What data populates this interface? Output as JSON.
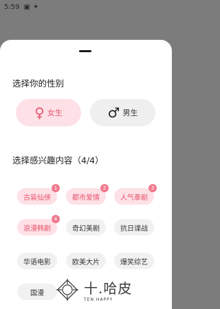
{
  "status_bar": {
    "time": "5:59",
    "icons": [
      "sim-card-icon",
      "notification-icon"
    ]
  },
  "gender_section": {
    "title": "选择你的性别",
    "options": [
      {
        "label": "女生",
        "icon": "female-icon",
        "symbol": "♀",
        "selected": true
      },
      {
        "label": "男生",
        "icon": "male-icon",
        "symbol": "♂",
        "selected": false
      }
    ]
  },
  "interest_section": {
    "title": "选择感兴趣内容（4/4）",
    "tags": [
      {
        "label": "古装仙侠",
        "selected": true,
        "badge": "1"
      },
      {
        "label": "都市爱情",
        "selected": true,
        "badge": "2"
      },
      {
        "label": "人气泰剧",
        "selected": true,
        "badge": "3"
      },
      {
        "label": "浪漫韩剧",
        "selected": true,
        "badge": "4"
      },
      {
        "label": "奇幻美剧",
        "selected": false,
        "badge": ""
      },
      {
        "label": "抗日谍战",
        "selected": false,
        "badge": ""
      },
      {
        "label": "华语电影",
        "selected": false,
        "badge": ""
      },
      {
        "label": "欧美大片",
        "selected": false,
        "badge": ""
      },
      {
        "label": "爆笑综艺",
        "selected": false,
        "badge": ""
      },
      {
        "label": "国漫",
        "selected": false,
        "badge": ""
      }
    ]
  },
  "watermark": {
    "brand": "十.哈皮",
    "sub": "TEN HAPPY"
  },
  "colors": {
    "accent": "#e8546e",
    "accent_bg": "#fde1e6",
    "badge": "#f07b8d"
  }
}
